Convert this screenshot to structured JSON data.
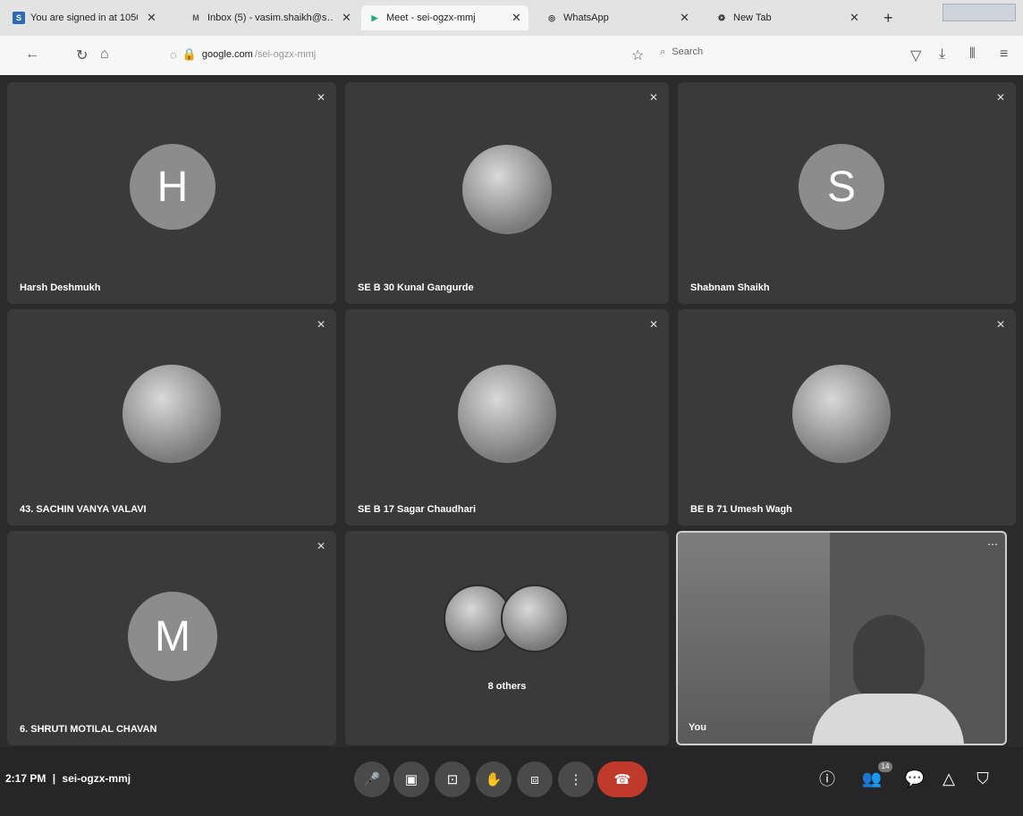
{
  "tabs": [
    {
      "title": "You are signed in at 1050",
      "favicon": "S",
      "favicon_color": "#2b6cb0"
    },
    {
      "title": "Inbox (5) - vasim.shaikh@s…",
      "favicon": "M"
    },
    {
      "title": "Meet - sei-ogzx-mmj",
      "favicon": "video"
    },
    {
      "title": "WhatsApp",
      "favicon": "whatsapp"
    },
    {
      "title": "New Tab",
      "favicon": "newtab"
    }
  ],
  "address": {
    "host": "google.com",
    "path": "/sei-ogzx-mmj"
  },
  "search_placeholder": "Search",
  "tiles": [
    {
      "name": "Harsh Deshmukh",
      "initial": "H",
      "kind": "letter"
    },
    {
      "name": "SE B 30 Kunal Gangurde",
      "kind": "photo"
    },
    {
      "name": "Shabnam Shaikh",
      "initial": "S",
      "kind": "letter"
    },
    {
      "name": "43. SACHIN VANYA VALAVI",
      "kind": "photo"
    },
    {
      "name": "SE B 17 Sagar Chaudhari",
      "kind": "photo"
    },
    {
      "name": "BE B 71 Umesh Wagh",
      "kind": "photo"
    },
    {
      "name": "6. SHRUTI MOTILAL CHAVAN",
      "initial": "M",
      "kind": "letter"
    }
  ],
  "others_label": "8 others",
  "self_label": "You",
  "meeting": {
    "time": "2:17 PM",
    "separator": "|",
    "code": "sei-ogzx-mmj"
  },
  "people_count": "14",
  "colors": {
    "end_call": "#c0392b",
    "tile_bg": "#3a3a3a",
    "avatar_bg": "#8c8c8c"
  }
}
